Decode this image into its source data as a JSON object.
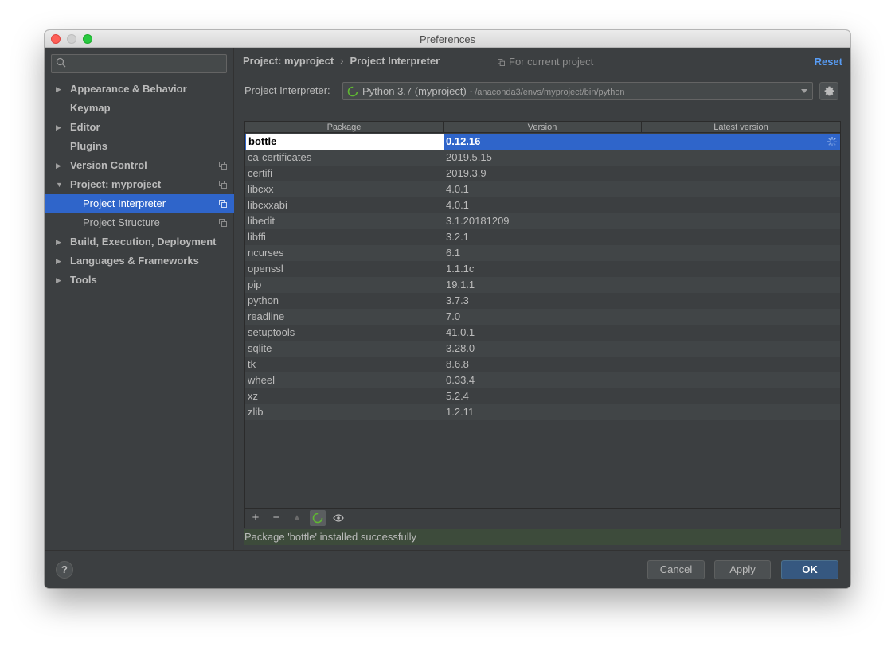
{
  "window": {
    "title": "Preferences"
  },
  "sidebar": {
    "search_placeholder": "",
    "items": [
      {
        "label": "Appearance & Behavior",
        "arrow": "▶"
      },
      {
        "label": "Keymap"
      },
      {
        "label": "Editor",
        "arrow": "▶"
      },
      {
        "label": "Plugins"
      },
      {
        "label": "Version Control",
        "arrow": "▶"
      },
      {
        "label": "Project: myproject",
        "arrow": "▼"
      },
      {
        "label": "Project Interpreter"
      },
      {
        "label": "Project Structure"
      },
      {
        "label": "Build, Execution, Deployment",
        "arrow": "▶"
      },
      {
        "label": "Languages & Frameworks",
        "arrow": "▶"
      },
      {
        "label": "Tools",
        "arrow": "▶"
      }
    ]
  },
  "header": {
    "crumb_parent": "Project: myproject",
    "crumb_sep": "›",
    "crumb_current": "Project Interpreter",
    "scope": "For current project",
    "reset": "Reset"
  },
  "interpreter": {
    "label": "Project Interpreter:",
    "name": "Python 3.7 (myproject)",
    "path": "~/anaconda3/envs/myproject/bin/python"
  },
  "table": {
    "columns": [
      "Package",
      "Version",
      "Latest version"
    ],
    "rows": [
      {
        "package": "bottle",
        "version": "0.12.16",
        "latest": ""
      },
      {
        "package": "ca-certificates",
        "version": "2019.5.15",
        "latest": ""
      },
      {
        "package": "certifi",
        "version": "2019.3.9",
        "latest": ""
      },
      {
        "package": "libcxx",
        "version": "4.0.1",
        "latest": ""
      },
      {
        "package": "libcxxabi",
        "version": "4.0.1",
        "latest": ""
      },
      {
        "package": "libedit",
        "version": "3.1.20181209",
        "latest": ""
      },
      {
        "package": "libffi",
        "version": "3.2.1",
        "latest": ""
      },
      {
        "package": "ncurses",
        "version": "6.1",
        "latest": ""
      },
      {
        "package": "openssl",
        "version": "1.1.1c",
        "latest": ""
      },
      {
        "package": "pip",
        "version": "19.1.1",
        "latest": ""
      },
      {
        "package": "python",
        "version": "3.7.3",
        "latest": ""
      },
      {
        "package": "readline",
        "version": "7.0",
        "latest": ""
      },
      {
        "package": "setuptools",
        "version": "41.0.1",
        "latest": ""
      },
      {
        "package": "sqlite",
        "version": "3.28.0",
        "latest": ""
      },
      {
        "package": "tk",
        "version": "8.6.8",
        "latest": ""
      },
      {
        "package": "wheel",
        "version": "0.33.4",
        "latest": ""
      },
      {
        "package": "xz",
        "version": "5.2.4",
        "latest": ""
      },
      {
        "package": "zlib",
        "version": "1.2.11",
        "latest": ""
      }
    ],
    "toolbar": {
      "add": "+",
      "remove": "−",
      "upgrade": "▲"
    }
  },
  "status": {
    "message": "Package 'bottle' installed successfully"
  },
  "footer": {
    "help": "?",
    "cancel": "Cancel",
    "apply": "Apply",
    "ok": "OK"
  },
  "colors": {
    "accent": "#2f65ca",
    "link": "#589df6",
    "success": "#3d4b3b",
    "spinner": "#5fb832"
  }
}
